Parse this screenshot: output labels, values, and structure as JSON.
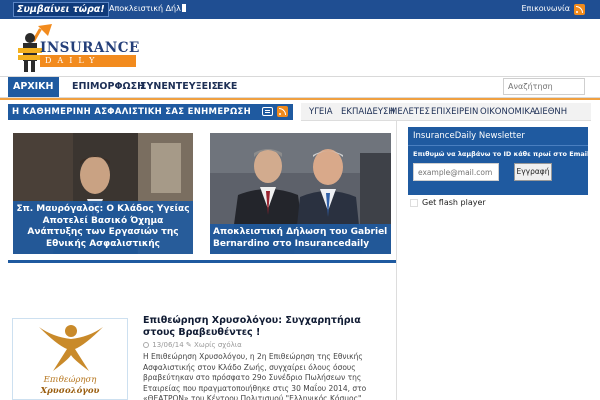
{
  "topbar": {
    "breaking_label": "Συμβαίνει τώρα!",
    "ticker_text": "Αποκλειστική Δήλ",
    "contact_label": "Επικοινωνία",
    "rss_icon": "rss-icon"
  },
  "logo": {
    "main": "INSURANCE",
    "sub": "DAILY"
  },
  "nav": {
    "items": [
      "ΑΡΧΙΚΗ",
      "ΕΠΙΜΟΡΦΩΣΗ",
      "ΣΥΝΕΝΤΕΥΞΕΙΣ",
      "ΕΚΕ"
    ],
    "active": "ΑΡΧΙΚΗ",
    "search_placeholder": "Αναζήτηση"
  },
  "section": {
    "title": "Η ΚΑΘΗΜΕΡΙΝΗ ΑΣΦΑΛΙΣΤΙΚΗ ΣΑΣ ΕΝΗΜΕΡΩΣΗ"
  },
  "categories": [
    "ΥΓΕΙΑ",
    "ΕΚΠΑΙΔΕΥΣΗ",
    "ΜΕΛΕΤΕΣ",
    "ΕΠΙΧΕΙΡΕΙΝ",
    "ΟΙΚΟΝΟΜΙΚΑ",
    "ΔΙΕΘΝΗ"
  ],
  "featured": [
    {
      "caption": "Σπ. Μαυρόγαλος: Ο Κλάδος Υγείας Αποτελεί Βασικό Όχημα Ανάπτυξης των Εργασιών της Εθνικής Ασφαλιστικής"
    },
    {
      "caption": "Αποκλειστική Δήλωση του Gabriel Bernardino στο Insurancedaily"
    }
  ],
  "article": {
    "thumb_label": "Επιθεώρηση",
    "thumb_label2": "Χρυσολόγου",
    "title": "Επιθεώρηση Χρυσολόγου: Συγχαρητήρια στους Βραβευθέντες !",
    "date": "13/06/14",
    "comments": "Χωρίς σχόλια",
    "body": "Η Επιθεώρηση Χρυσολόγου, η 2η Επιθεώρηση της Εθνικής Ασφαλιστικής στον Κλάδο Ζωής, συγχαίρει όλους όσους βραβεύτηκαν στο πρόσφατο 29ο Συνέδριο Πωλήσεων της Εταιρείας που πραγματοποιήθηκε στις 30 Μαΐου 2014, στο «ΘΕΑΤΡΟΝ» του Κέντρου Πολιτισμού \"Ελληνικός Κόσμος\",..."
  },
  "newsletter": {
    "title": "InsuranceDaily Newsletter",
    "desc": "Επιθυμώ να λαμβάνω το ID κάθε πρωί στο Email μου",
    "email_placeholder": "example@mail.com",
    "submit": "Εγγραφή"
  },
  "flash": {
    "label": "Get flash player"
  },
  "colors": {
    "brand_blue": "#1f5aa0",
    "topbar_blue": "#1f4e92",
    "accent_orange": "#f28b1e"
  }
}
